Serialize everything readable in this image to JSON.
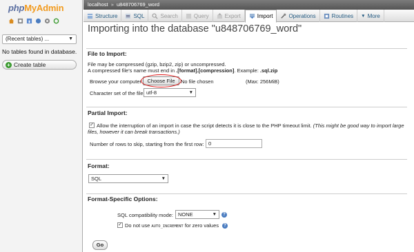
{
  "logo": {
    "php": "php",
    "myadmin": "MyAdmin"
  },
  "nav_icons": [
    "home-icon",
    "exit-icon",
    "info-icon",
    "help-icon",
    "settings-icon",
    "reload-icon"
  ],
  "sidebar": {
    "recent_tables": "(Recent tables) ...",
    "no_tables": "No tables found in database.",
    "create_table": "Create table"
  },
  "breadcrumb": {
    "server": "localhost",
    "separator": "»",
    "database": "u848706769_word"
  },
  "tabs": [
    {
      "label": "Structure",
      "icon": "structure-icon"
    },
    {
      "label": "SQL",
      "icon": "sql-icon"
    },
    {
      "label": "Search",
      "icon": "search-icon"
    },
    {
      "label": "Query",
      "icon": "query-icon"
    },
    {
      "label": "Export",
      "icon": "export-icon"
    },
    {
      "label": "Import",
      "icon": "import-icon"
    },
    {
      "label": "Operations",
      "icon": "operations-icon"
    },
    {
      "label": "Routines",
      "icon": "routines-icon"
    },
    {
      "label": "More",
      "icon": "chevron-down-icon"
    }
  ],
  "page_title": "Importing into the database \"u848706769_word\"",
  "file_import": {
    "heading": "File to Import:",
    "compress_note": "File may be compressed (gzip, bzip2, zip) or uncompressed.",
    "name_note_prefix": "A compressed file's name must end in",
    "name_note_format": ".[format].[compression]",
    "name_note_example_label": ". Example:",
    "name_note_example": ".sql.zip",
    "browse_label": "Browse your computer:",
    "choose_file": "Choose File",
    "no_file": "No file chosen",
    "max_size": "(Max: 256MiB)",
    "charset_label": "Character set of the file:",
    "charset_value": "utf-8"
  },
  "partial_import": {
    "heading": "Partial Import:",
    "allow_interrupt": "Allow the interruption of an import in case the script detects it is close to the PHP timeout limit.",
    "allow_interrupt_note_1": "(This might be good way to import large",
    "allow_interrupt_note_2": "files, however it can break transactions.)",
    "allow_checked": true,
    "skip_label": "Number of rows to skip, starting from the first row:",
    "skip_value": "0"
  },
  "format": {
    "heading": "Format:",
    "value": "SQL"
  },
  "format_options": {
    "heading": "Format-Specific Options:",
    "compat_label": "SQL compatibility mode:",
    "compat_value": "NONE",
    "no_auto_inc_prefix": "Do not use",
    "no_auto_inc_code": "AUTO_INCREMENT",
    "no_auto_inc_suffix": "for zero values",
    "no_auto_inc_checked": true
  },
  "go_button": "Go",
  "colors": {
    "accent": "#235a81",
    "logo_php": "#5a6ea0",
    "logo_myadmin": "#f29b1f",
    "highlight_circle": "#dd1111"
  }
}
